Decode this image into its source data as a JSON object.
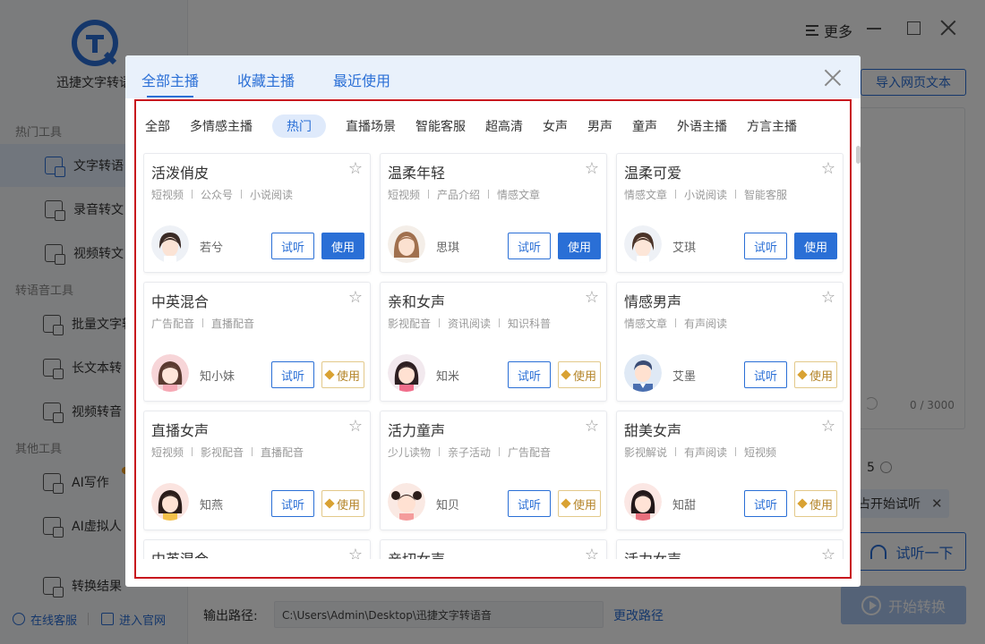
{
  "app": {
    "name": "迅捷文字转语",
    "more": "更多",
    "import_btn": "导入网页文本",
    "counter": "0 / 3000",
    "speed_value": "5",
    "tooltip_text": "占开始试听",
    "listen_btn": "试听一下",
    "start_btn": "开始转换",
    "output_label": "输出路径:",
    "output_path": "C:\\Users\\Admin\\Desktop\\迅捷文字转语音",
    "change_path": "更改路径",
    "support": "在线客服",
    "website": "进入官网"
  },
  "sidebar": {
    "sec1": "热门工具",
    "sec2": "转语音工具",
    "sec3": "其他工具",
    "items": [
      {
        "label": "文字转语"
      },
      {
        "label": "录音转文"
      },
      {
        "label": "视频转文"
      },
      {
        "label": "批量文字转"
      },
      {
        "label": "长文本转"
      },
      {
        "label": "视频转音"
      },
      {
        "label": "AI写作"
      },
      {
        "label": "AI虚拟人"
      },
      {
        "label": "转换结果"
      }
    ]
  },
  "modal": {
    "tabs": [
      {
        "label": "全部主播"
      },
      {
        "label": "收藏主播"
      },
      {
        "label": "最近使用"
      }
    ],
    "filters": [
      {
        "label": "全部"
      },
      {
        "label": "多情感主播"
      },
      {
        "label": "热门"
      },
      {
        "label": "直播场景"
      },
      {
        "label": "智能客服"
      },
      {
        "label": "超高清"
      },
      {
        "label": "女声"
      },
      {
        "label": "男声"
      },
      {
        "label": "童声"
      },
      {
        "label": "外语主播"
      },
      {
        "label": "方言主播"
      }
    ],
    "try_label": "试听",
    "use_label": "使用",
    "star": "☆",
    "cards": [
      {
        "title": "活泼俏皮",
        "t1": "短视频",
        "t2": "公众号",
        "t3": "小说阅读",
        "voice": "若兮"
      },
      {
        "title": "温柔年轻",
        "t1": "短视频",
        "t2": "产品介绍",
        "t3": "情感文章",
        "voice": "思琪"
      },
      {
        "title": "温柔可爱",
        "t1": "情感文章",
        "t2": "小说阅读",
        "t3": "智能客服",
        "voice": "艾琪"
      },
      {
        "title": "中英混合",
        "t1": "广告配音",
        "t2": "直播配音",
        "t3": "",
        "voice": "知小妹"
      },
      {
        "title": "亲和女声",
        "t1": "影视配音",
        "t2": "资讯阅读",
        "t3": "知识科普",
        "voice": "知米"
      },
      {
        "title": "情感男声",
        "t1": "情感文章",
        "t2": "有声阅读",
        "t3": "",
        "voice": "艾墨"
      },
      {
        "title": "直播女声",
        "t1": "短视频",
        "t2": "影视配音",
        "t3": "直播配音",
        "voice": "知燕"
      },
      {
        "title": "活力童声",
        "t1": "少儿读物",
        "t2": "亲子活动",
        "t3": "广告配音",
        "voice": "知贝"
      },
      {
        "title": "甜美女声",
        "t1": "影视解说",
        "t2": "有声阅读",
        "t3": "短视频",
        "voice": "知甜"
      },
      {
        "title": "中英混合"
      },
      {
        "title": "亲切女声"
      },
      {
        "title": "活力女声"
      }
    ]
  }
}
